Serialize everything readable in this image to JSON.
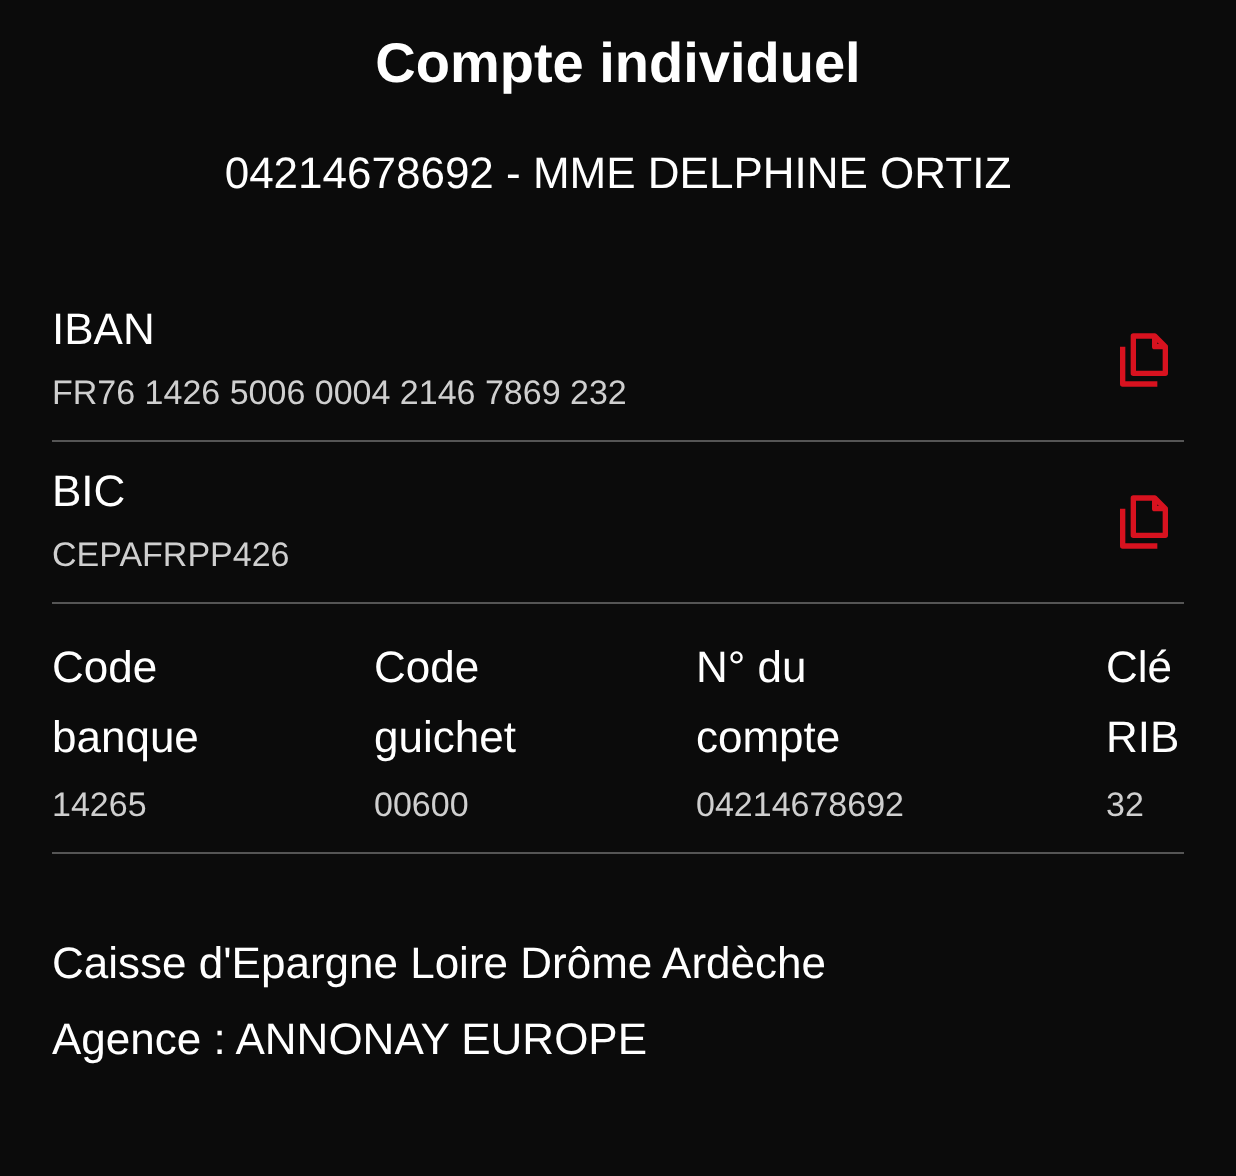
{
  "title": "Compte individuel",
  "account_holder": "04214678692 - MME DELPHINE ORTIZ",
  "fields": [
    {
      "label": "IBAN",
      "value": "FR76 1426 5006 0004 2146 7869 232"
    },
    {
      "label": "BIC",
      "value": "CEPAFRPP426"
    }
  ],
  "rib": [
    {
      "label": "Code banque",
      "value": "14265"
    },
    {
      "label": "Code guichet",
      "value": "00600"
    },
    {
      "label": "N° du compte",
      "value": "04214678692"
    },
    {
      "label": "Clé RIB",
      "value": "32"
    }
  ],
  "bank": {
    "name": "Caisse d'Epargne Loire Drôme Ardèche",
    "agency": "Agence : ANNONAY EUROPE"
  }
}
